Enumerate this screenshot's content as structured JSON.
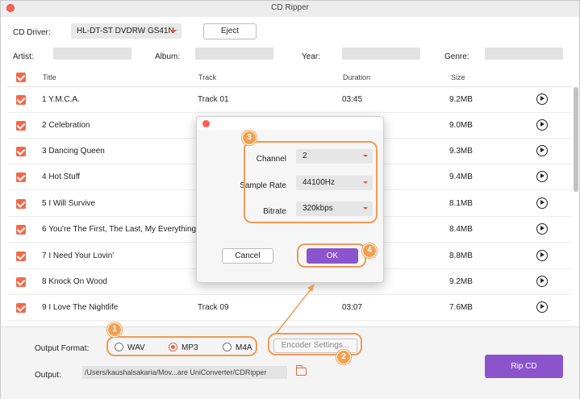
{
  "window": {
    "title": "CD Ripper"
  },
  "drive": {
    "label": "CD Driver:",
    "value": "HL-DT-ST DVDRW GS41N",
    "eject_label": "Eject"
  },
  "meta": {
    "artist_label": "Artist:",
    "album_label": "Album:",
    "year_label": "Year:",
    "genre_label": "Genre:"
  },
  "columns": {
    "title": "Title",
    "track": "Track",
    "duration": "Duration",
    "size": "Size"
  },
  "tracks": [
    {
      "title": "1 Y.M.C.A.",
      "track": "Track 01",
      "duration": "03:45",
      "size": "9.2MB"
    },
    {
      "title": "2 Celebration",
      "track": "",
      "duration": "",
      "size": "9.0MB"
    },
    {
      "title": "3 Dancing Queen",
      "track": "",
      "duration": "",
      "size": "9.3MB"
    },
    {
      "title": "4 Hot Stuff",
      "track": "",
      "duration": "",
      "size": "9.4MB"
    },
    {
      "title": "5 I Will Survive",
      "track": "",
      "duration": "",
      "size": "8.1MB"
    },
    {
      "title": "6 You're The First, The Last, My Everything",
      "track": "",
      "duration": "",
      "size": "8.4MB"
    },
    {
      "title": "7 I Need Your Lovin'",
      "track": "",
      "duration": "",
      "size": "8.8MB"
    },
    {
      "title": "8 Knock On Wood",
      "track": "",
      "duration": "",
      "size": "9.2MB"
    },
    {
      "title": "9 I Love The Nightlife",
      "track": "Track 09",
      "duration": "03:07",
      "size": "7.6MB"
    }
  ],
  "output": {
    "format_label": "Output Format:",
    "formats": [
      "WAV",
      "MP3",
      "M4A"
    ],
    "selected_format": "MP3",
    "encoder_label": "Encoder Settings...",
    "path_label": "Output:",
    "path": "/Users/kaushalsakaria/Mov...are UniConverter/CDRipper",
    "rip_label": "Rip CD"
  },
  "dialog": {
    "channel_label": "Channel",
    "channel_value": "2",
    "sample_rate_label": "Sample Rate",
    "sample_rate_value": "44100Hz",
    "bitrate_label": "Bitrate",
    "bitrate_value": "320kbps",
    "cancel_label": "Cancel",
    "ok_label": "OK"
  },
  "steps": [
    "1",
    "2",
    "3",
    "4"
  ],
  "colors": {
    "accent": "#8b54cc",
    "checkbox": "#f0694a",
    "callout": "#f09a55"
  }
}
